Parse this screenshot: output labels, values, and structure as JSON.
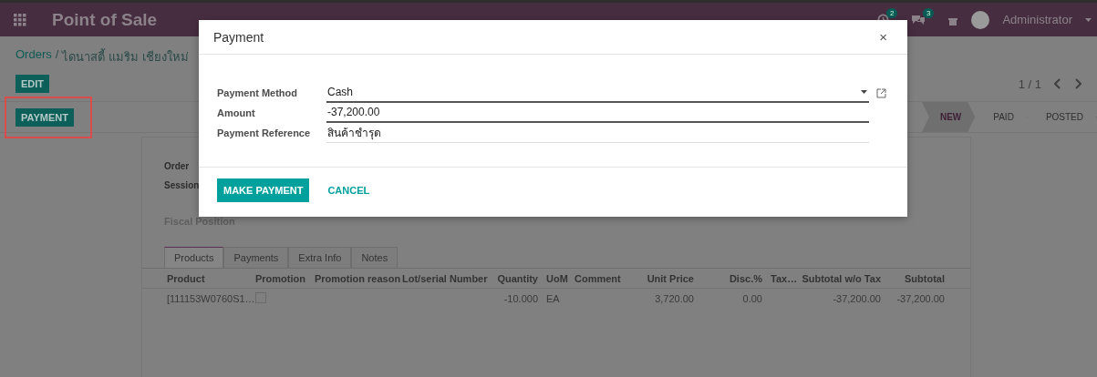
{
  "navbar": {
    "app_title": "Point of Sale",
    "activity_count": "2",
    "message_count": "3",
    "user": "Administrator"
  },
  "breadcrumb": {
    "parent": "Orders",
    "separator": "/",
    "current": "ไดนาสตี้ แมริม เชียงใหม่"
  },
  "control_panel": {
    "edit_button": "EDIT",
    "pager": "1 / 1",
    "action_buttons": [
      {
        "label": "PAYMENT",
        "highlighted": true
      }
    ],
    "statuses": [
      {
        "label": "NEW",
        "selected": true
      },
      {
        "label": "PAID",
        "selected": false
      },
      {
        "label": "POSTED",
        "selected": false
      }
    ]
  },
  "form": {
    "labels": [
      "Order",
      "Session"
    ],
    "fiscal_position_label": "Fiscal Position",
    "tabs": [
      {
        "label": "Products",
        "selected": true
      },
      {
        "label": "Payments",
        "selected": false
      },
      {
        "label": "Extra Info",
        "selected": false
      },
      {
        "label": "Notes",
        "selected": false
      }
    ],
    "columns": [
      "Product",
      "Promotion",
      "Promotion reason",
      "Lot/serial Number",
      "Quantity",
      "UoM",
      "Comment",
      "Unit Price",
      "Disc.%",
      "Tax…",
      "Subtotal w/o Tax",
      "Subtotal"
    ],
    "rows": [
      {
        "product": "[111153W0760S1…",
        "promotion_checked": false,
        "quantity": "-10.000",
        "uom": "EA",
        "unit_price": "3,720.00",
        "discount": "0.00",
        "subtotal_wo_tax": "-37,200.00",
        "subtotal": "-37,200.00"
      }
    ]
  },
  "dialog": {
    "title": "Payment",
    "close": "×",
    "fields": [
      {
        "kind": "select",
        "label": "Payment Method",
        "value": "Cash"
      },
      {
        "kind": "input",
        "label": "Amount",
        "value": "-37,200.00"
      },
      {
        "kind": "text",
        "label": "Payment Reference",
        "value": "สินค้าชำรุด"
      }
    ],
    "primary_button": "MAKE PAYMENT",
    "secondary_button": "CANCEL"
  }
}
